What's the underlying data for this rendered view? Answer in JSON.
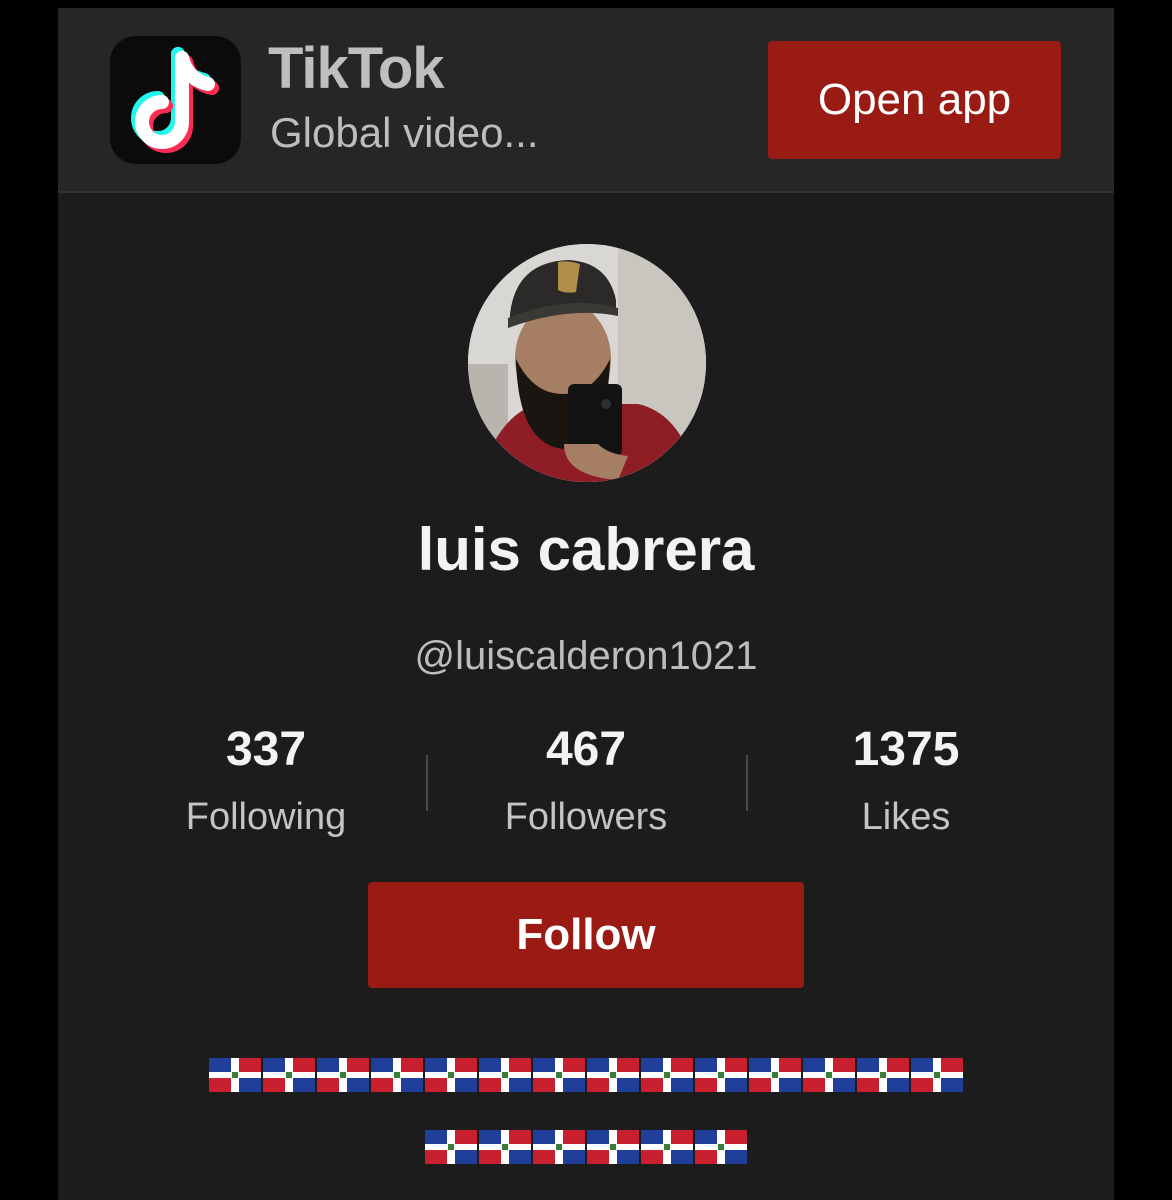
{
  "banner": {
    "app_name": "TikTok",
    "subtitle": "Global video...",
    "open_app_label": "Open app"
  },
  "profile": {
    "display_name": "luis cabrera",
    "handle": "@luiscalderon1021",
    "stats": [
      {
        "value": "337",
        "label": "Following"
      },
      {
        "value": "467",
        "label": "Followers"
      },
      {
        "value": "1375",
        "label": "Likes"
      }
    ],
    "follow_label": "Follow",
    "bio": {
      "line1": "🇩🇴🇩🇴🇩🇴🇩🇴🇩🇴🇩🇴🇩🇴🇩🇴🇩🇴🇩🇴🇩🇴🇩🇴🇩🇴🇩🇴",
      "line2": "🇩🇴🇩🇴🇩🇴🇩🇴🇩🇴🇩🇴"
    }
  },
  "icons": {
    "app_icon": "tiktok-logo-icon",
    "bio_emoji": "dominican-republic-flag"
  },
  "colors": {
    "accent": "#9a1b14",
    "background": "#1c1c1d",
    "banner": "#262627",
    "text_primary": "#f3f3f3",
    "text_secondary": "#bdbdbe"
  }
}
